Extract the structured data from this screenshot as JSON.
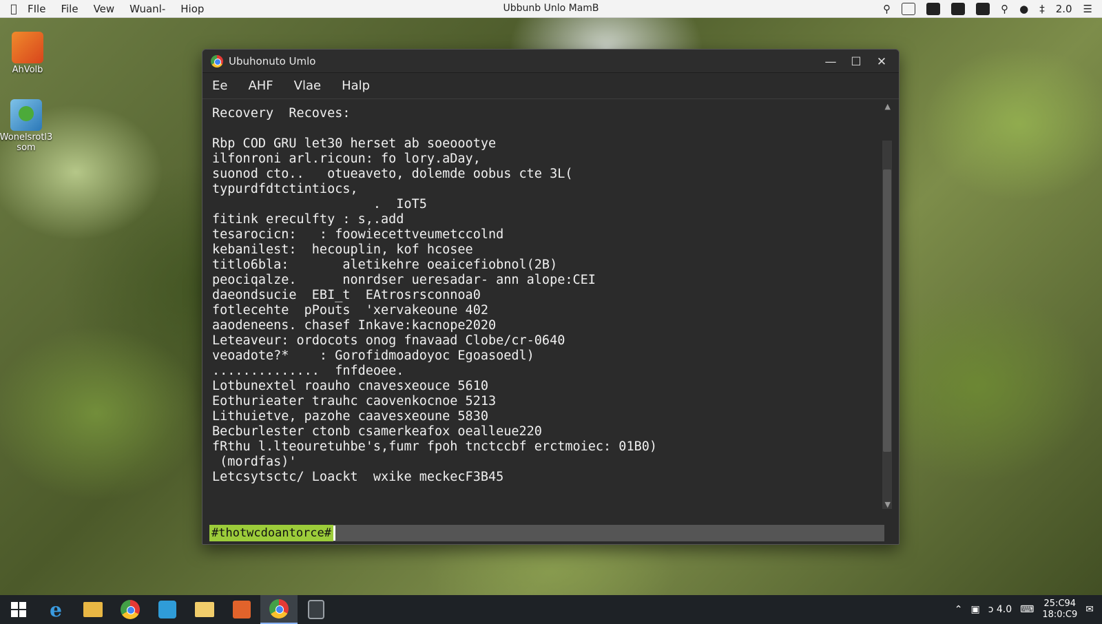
{
  "menubar": {
    "apple_icon": "apple-icon",
    "items": [
      "FIle",
      "File",
      "Vew",
      "Wuanl-",
      "Hiop"
    ],
    "title": "Ubbunb Unlo MamB",
    "status_icons": [
      "search-icon",
      "calendar-icon",
      "notes-icon",
      "cloud-icon",
      "display-icon",
      "magnifier-icon",
      "location-icon",
      "bluetooth-icon",
      "menu-icon"
    ],
    "status_text": "2.0"
  },
  "desktop": {
    "icons": [
      {
        "label": "AhVolb",
        "icon": "app-icon"
      },
      {
        "label": "Wonelsrotl3 som",
        "icon": "network-icon"
      }
    ]
  },
  "window": {
    "title": "Ubuhonuto Umlo",
    "menu": [
      "Ee",
      "AHF",
      "Vlae",
      "Halp"
    ],
    "controls": {
      "minimize": "—",
      "maximize": "☐",
      "close": "✕"
    },
    "terminal_lines": [
      "Recovery  Recoves:",
      "",
      "Rbp COD GRU let30 herset ab soeoootye",
      "ilfonroni arl.ricoun: fo lory.aDay,",
      "suonod cto..   otueaveto, dolemde oobus cte 3L(",
      "typurdfdtctintiocs,",
      "                     .  IoT5",
      "fitink ereculfty : s,.add",
      "tesarocicn:   : foowiecettveumetccolnd",
      "kebanilest:  hecouplin, kof hcosee",
      "titlo6bla:       aletikehre oeaicefiobnol(2B)",
      "peociqalze.      nonrdser ueresadar- ann alope:CEI",
      "daeondsucie  EBI_t  EAtrosrsconnoa0",
      "fotlecehte  pPouts  'xervakeoune 402",
      "aaodeneens. chasef Inkave:kacnope2020",
      "Leteaveur: ordocots onog fnavaad Clobe/cr-0640",
      "veoadote?*    : Gorofidmoadoyoc Egoasoedl)",
      "..............  fnfdeoee.",
      "Lotbunextel roauho cnavesxeouce 5610",
      "Eothurieater trauhc caovenkocnoe 5213",
      "Lithuietve, pazohe caavesxeoune 5830",
      "Becburlester ctonb csamerkeafox oealleue220",
      "fRthu l.lteouretuhbe's,fumr fpoh tnctccbf erctmoiec: 01B0)",
      " (mordfas)'",
      "Letcsytsctc/ Loackt  wxike meckecF3B45"
    ],
    "prompt": "#thotwcdoantorce#"
  },
  "taskbar": {
    "apps": [
      "windows-start-icon",
      "internet-explorer-icon",
      "file-explorer-icon",
      "firefox-icon",
      "store-icon",
      "folder-icon",
      "office-icon",
      "chrome-icon",
      "terminal-icon"
    ],
    "tray_text": "ɔ 4.0",
    "clock_time": "25:C94",
    "clock_date": "18:0:C9"
  }
}
